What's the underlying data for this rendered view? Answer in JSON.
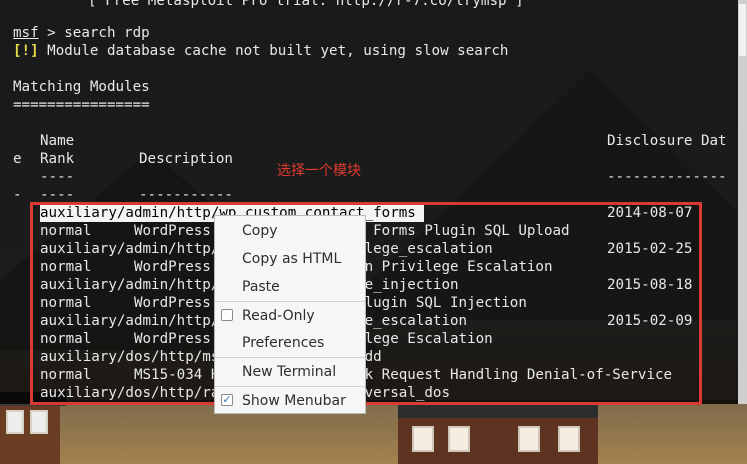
{
  "terminal": {
    "header": "[ Free Metasploit Pro trial: http://r-7.co/trymsp ]",
    "prompt": "msf",
    "command": " > search rdp",
    "warn_tag": "[!]",
    "warn_text": " Module database cache not built yet, using slow search",
    "section_title": "Matching Modules",
    "section_rule": "================",
    "col_name": "Name",
    "col_disclosure": "Disclosure Dat",
    "col_e": "e",
    "col_rank": "Rank",
    "col_description": "Description",
    "dash_name": "----",
    "dash_disclosure": "--------------",
    "dash_e": "-",
    "dash_rank": "----",
    "dash_description": "-----------",
    "annotation": "选择一个模块",
    "rows": [
      {
        "left": "auxiliary/admin/http/wp_custom_contact_forms ",
        "right": "2014-08-07"
      },
      {
        "left": "normal     WordPress WP Custom Contact Forms Plugin SQL Upload",
        "right": ""
      },
      {
        "left": "auxiliary/admin/http/wp_easycart_privilege_escalation",
        "right": "2015-02-25"
      },
      {
        "left": "normal     WordPress WP EasyCart Plugin Privilege Escalation",
        "right": ""
      },
      {
        "left": "auxiliary/admin/http/wp_gdpr_compliance_injection",
        "right": "2015-08-18"
      },
      {
        "left": "normal     WordPress GDPR Compliance Plugin SQL Injection",
        "right": ""
      },
      {
        "left": "auxiliary/admin/http/wp_wplms_privilege_escalation",
        "right": "2015-02-09"
      },
      {
        "left": "normal     WordPress WPLMS Theme Privilege Escalation",
        "right": ""
      },
      {
        "left": "auxiliary/dos/http/ms15_034_ulonglongadd",
        "right": ""
      },
      {
        "left": "normal     MS15-034 HTTP Protocol Stack Request Handling Denial-of-Service",
        "right": ""
      },
      {
        "left": "auxiliary/dos/http/rails_directory_traversal_dos",
        "right": ""
      }
    ]
  },
  "context_menu": {
    "items": [
      {
        "label": "Copy"
      },
      {
        "label": "Copy as HTML"
      },
      {
        "label": "Paste"
      },
      {
        "label": "Read-Only",
        "checkbox": true,
        "checked": false
      },
      {
        "label": "Preferences"
      },
      {
        "label": "New Terminal"
      },
      {
        "label": "Show Menubar",
        "checkbox": true,
        "checked": true
      }
    ]
  },
  "colors": {
    "annotation": "#e13b2f",
    "highlight_box": "#d93a32",
    "warning": "#e6d94a",
    "checkmark": "#3a6fb0"
  }
}
